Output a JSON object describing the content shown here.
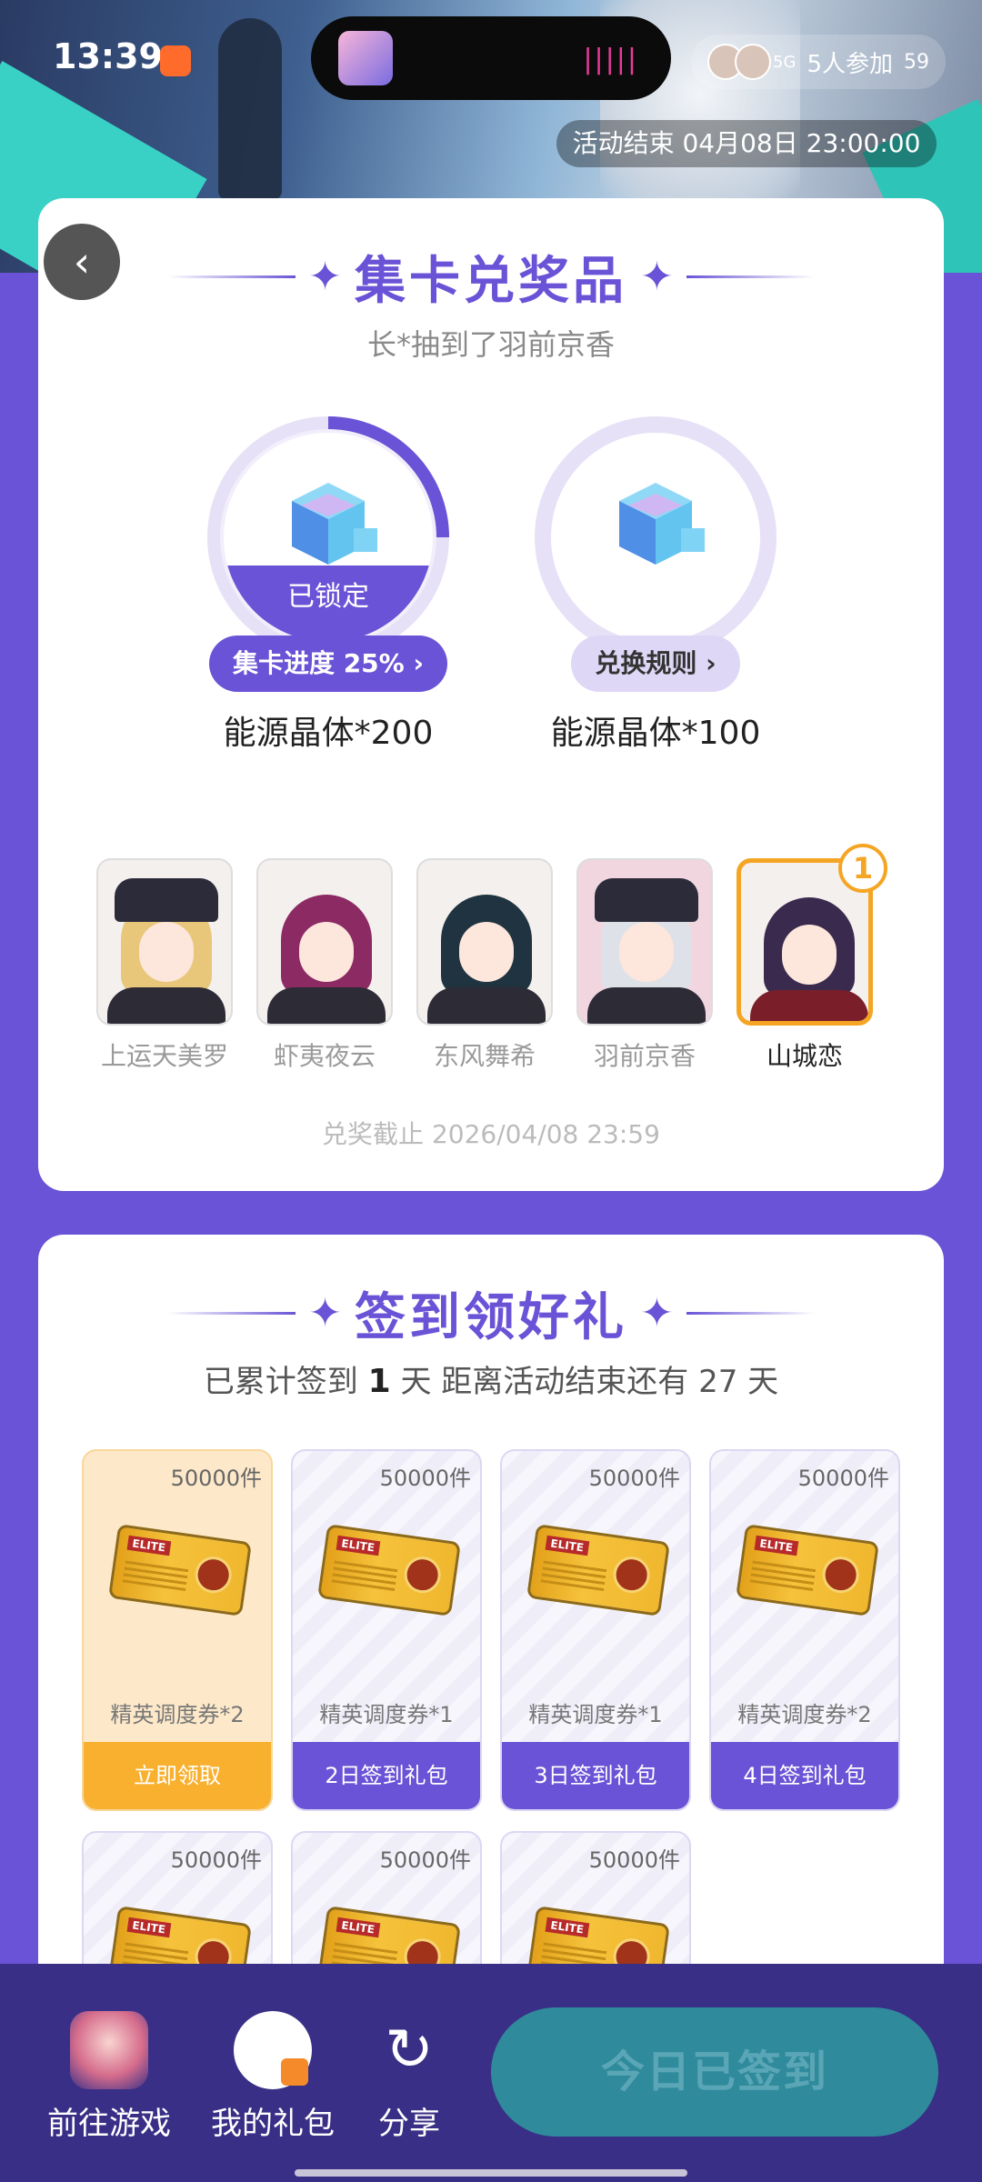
{
  "status_bar": {
    "time": "13:39",
    "network": "5G",
    "right_text": "5人参加",
    "battery": "59"
  },
  "banner": {
    "end_time": "活动结束 04月08日 23:00:00"
  },
  "collect": {
    "title": "集卡兑奖品",
    "subtitle": "长*抽到了羽前京香",
    "prizes": [
      {
        "name": "能源晶体*200",
        "lock_label": "已锁定",
        "button": "集卡进度 25%",
        "progress": 25
      },
      {
        "name": "能源晶体*100",
        "button": "兑换规则"
      }
    ],
    "characters": [
      {
        "name": "上运天美罗"
      },
      {
        "name": "虾夷夜云"
      },
      {
        "name": "东风舞希"
      },
      {
        "name": "羽前京香"
      },
      {
        "name": "山城恋",
        "count": "1"
      }
    ],
    "deadline": "兑奖截止 2026/04/08 23:59"
  },
  "checkin": {
    "title": "签到领好礼",
    "progress_prefix": "已累计签到",
    "days_signed": "1",
    "progress_mid": "天  距离活动结束还有 27 天",
    "rewards": [
      {
        "qty": "50000件",
        "name": "精英调度券*2",
        "button": "立即领取",
        "elite": "ELITE"
      },
      {
        "qty": "50000件",
        "name": "精英调度券*1",
        "button": "2日签到礼包",
        "elite": "ELITE"
      },
      {
        "qty": "50000件",
        "name": "精英调度券*1",
        "button": "3日签到礼包",
        "elite": "ELITE"
      },
      {
        "qty": "50000件",
        "name": "精英调度券*2",
        "button": "4日签到礼包",
        "elite": "ELITE"
      },
      {
        "qty": "50000件",
        "elite": "ELITE"
      },
      {
        "qty": "50000件",
        "elite": "ELITE"
      },
      {
        "qty": "50000件",
        "elite": "ELITE"
      }
    ]
  },
  "bottom_bar": {
    "go_game": "前往游戏",
    "my_gifts": "我的礼包",
    "share": "分享",
    "signed_today": "今日已签到"
  },
  "colors": {
    "accent": "#6a53d6",
    "highlight": "#f5a524",
    "bottom_bar": "#3a2f86",
    "signed_button": "#2f8b9c"
  }
}
